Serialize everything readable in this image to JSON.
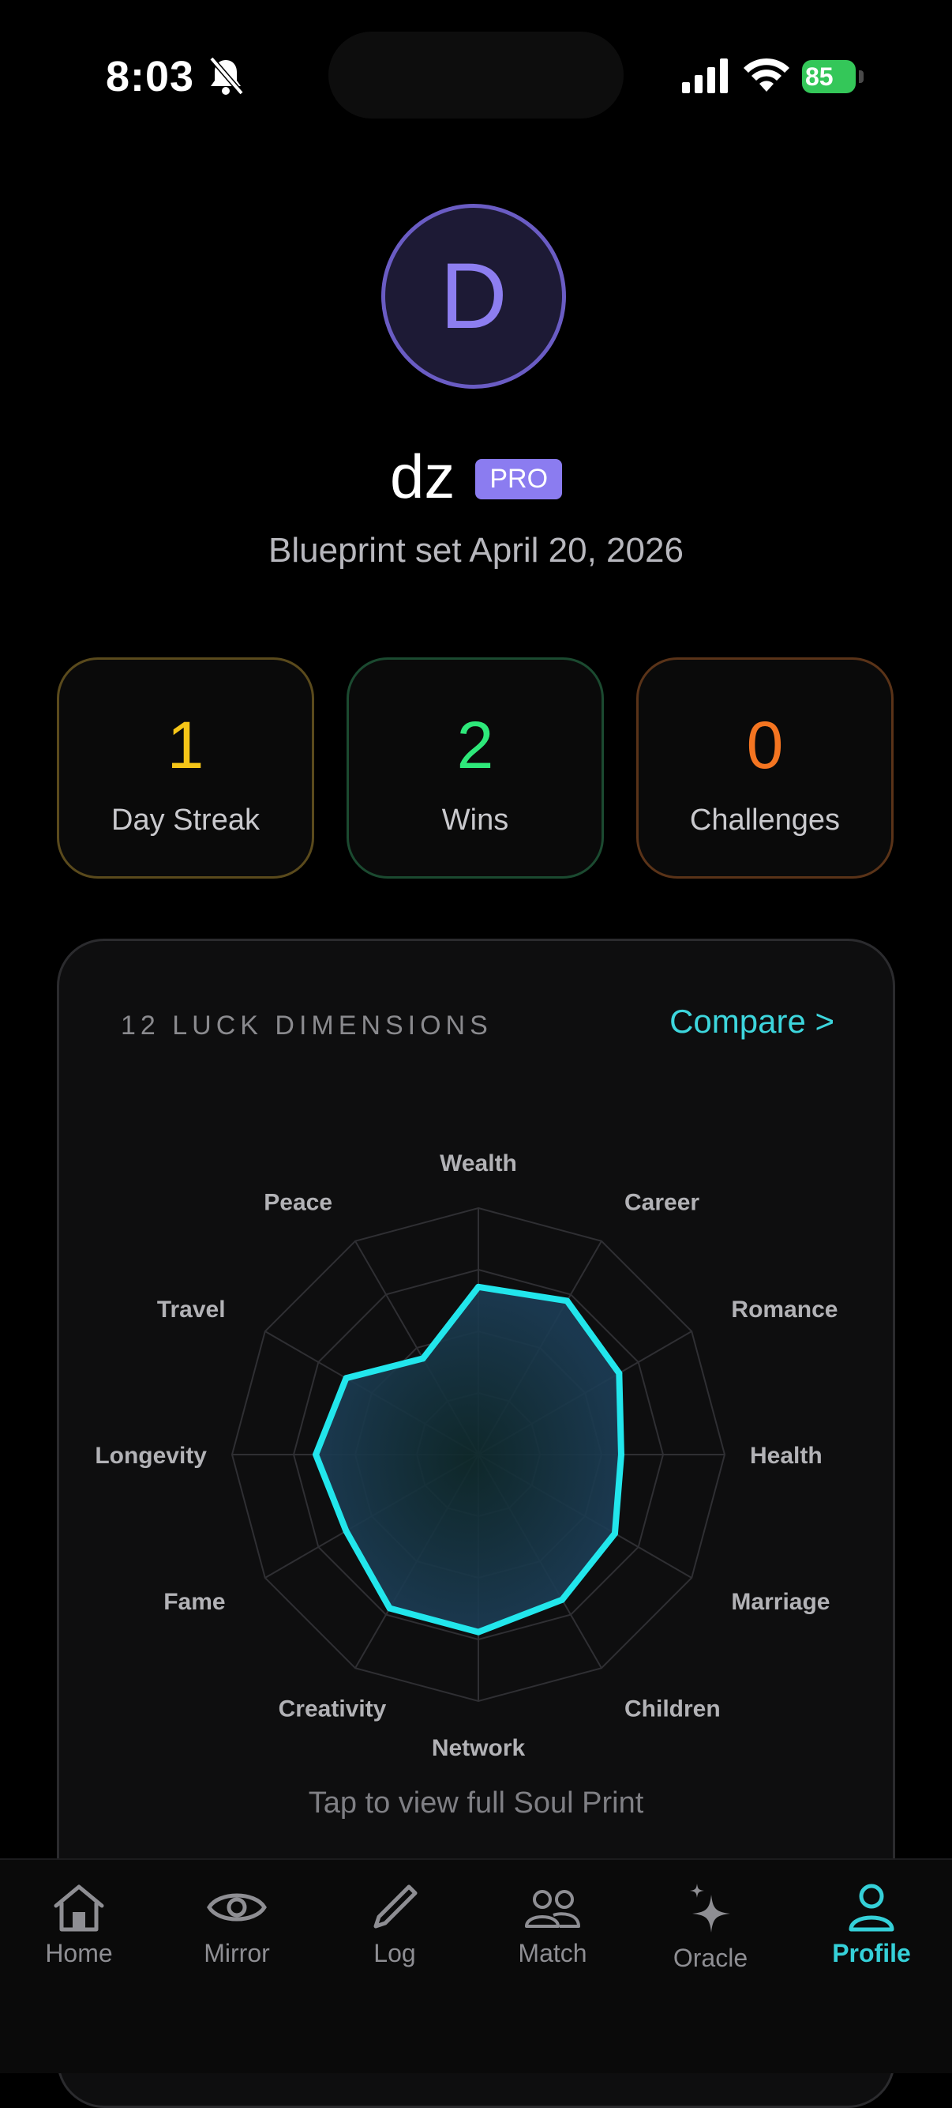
{
  "status": {
    "time": "8:03",
    "battery": "85"
  },
  "profile": {
    "initial": "D",
    "username": "dz",
    "badge": "PRO",
    "blueprint": "Blueprint set April 20, 2026"
  },
  "stats": [
    {
      "value": "1",
      "label": "Day Streak",
      "color": "#f5c518",
      "border": "#5a4a1c"
    },
    {
      "value": "2",
      "label": "Wins",
      "color": "#2ee87a",
      "border": "#1b4a30"
    },
    {
      "value": "0",
      "label": "Challenges",
      "color": "#f47521",
      "border": "#5a3318"
    }
  ],
  "luck": {
    "title": "12 LUCK DIMENSIONS",
    "compare": "Compare >",
    "tap": "Tap to view full Soul Print",
    "accent": "#22e6ec"
  },
  "chart_data": {
    "type": "radar",
    "categories": [
      "Wealth",
      "Career",
      "Romance",
      "Health",
      "Marriage",
      "Children",
      "Network",
      "Creativity",
      "Fame",
      "Longevity",
      "Travel",
      "Peace"
    ],
    "values": [
      68,
      72,
      66,
      58,
      64,
      68,
      72,
      72,
      62,
      66,
      62,
      45
    ],
    "rlim": [
      0,
      100
    ],
    "grid_rings": 4,
    "grid": true
  },
  "tabs": [
    {
      "label": "Home",
      "icon": "home-icon",
      "active": false
    },
    {
      "label": "Mirror",
      "icon": "eye-icon",
      "active": false
    },
    {
      "label": "Log",
      "icon": "pencil-icon",
      "active": false
    },
    {
      "label": "Match",
      "icon": "people-icon",
      "active": false
    },
    {
      "label": "Oracle",
      "icon": "sparkle-icon",
      "active": false
    },
    {
      "label": "Profile",
      "icon": "person-icon",
      "active": true
    }
  ]
}
